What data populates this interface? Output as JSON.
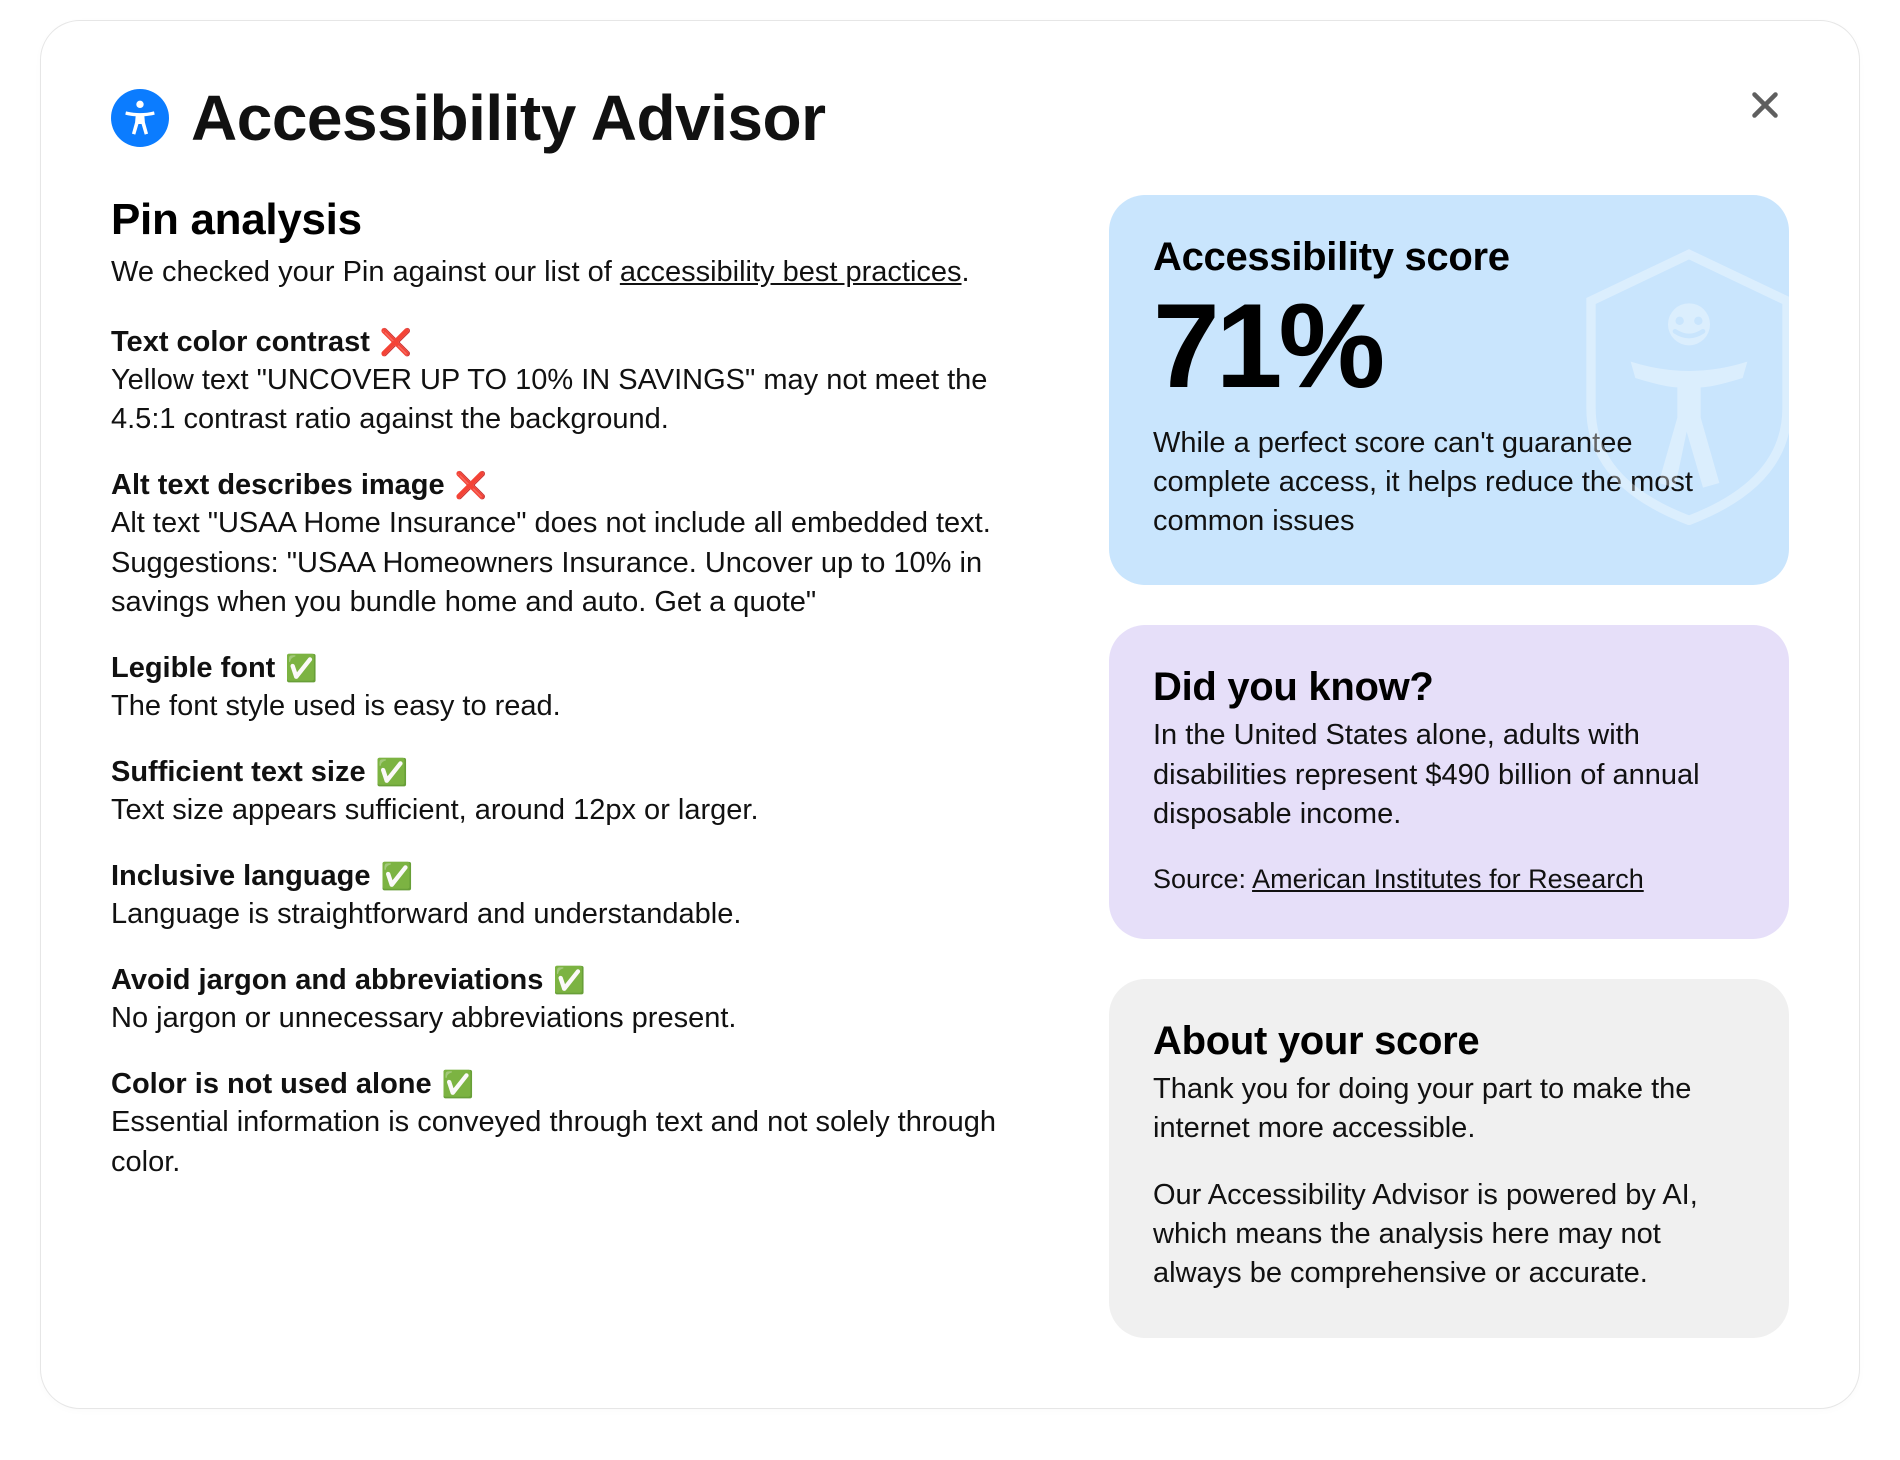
{
  "modal": {
    "title": "Accessibility Advisor"
  },
  "analysis": {
    "heading": "Pin analysis",
    "intro_prefix": "We checked your Pin against our list of ",
    "intro_link": "accessibility best practices",
    "intro_suffix": ".",
    "checks": [
      {
        "title": "Text color contrast",
        "status": "fail",
        "desc": "Yellow text \"UNCOVER UP TO 10% IN SAVINGS\" may not meet the 4.5:1 contrast ratio against the background."
      },
      {
        "title": "Alt text describes image",
        "status": "fail",
        "desc": "Alt text \"USAA Home Insurance\" does not include all embedded text. Suggestions: \"USAA Homeowners Insurance. Uncover up to 10% in savings when you bundle home and auto. Get a quote\""
      },
      {
        "title": "Legible font",
        "status": "pass",
        "desc": "The font style used is easy to read."
      },
      {
        "title": "Sufficient text size",
        "status": "pass",
        "desc": "Text size appears sufficient, around 12px or larger."
      },
      {
        "title": "Inclusive language",
        "status": "pass",
        "desc": "Language is straightforward and understandable."
      },
      {
        "title": "Avoid jargon and abbreviations",
        "status": "pass",
        "desc": "No jargon or unnecessary abbreviations present."
      },
      {
        "title": "Color is not used alone",
        "status": "pass",
        "desc": "Essential information is conveyed through text and not solely through color."
      }
    ]
  },
  "score_card": {
    "heading": "Accessibility score",
    "value": "71%",
    "note": "While a perfect score can't guarantee complete access, it helps reduce the most common issues"
  },
  "fact_card": {
    "heading": "Did you know?",
    "body": "In the United States alone, adults with disabilities represent $490 billion of annual disposable income.",
    "source_label": "Source: ",
    "source_link": "American Institutes for Research"
  },
  "about_card": {
    "heading": "About your score",
    "p1": "Thank you for doing your part to make the internet more accessible.",
    "p2": "Our Accessibility Advisor is powered by AI, which means the analysis here may not always be comprehensive or accurate."
  },
  "icons": {
    "status_pass": "✅",
    "status_fail": "❌"
  }
}
